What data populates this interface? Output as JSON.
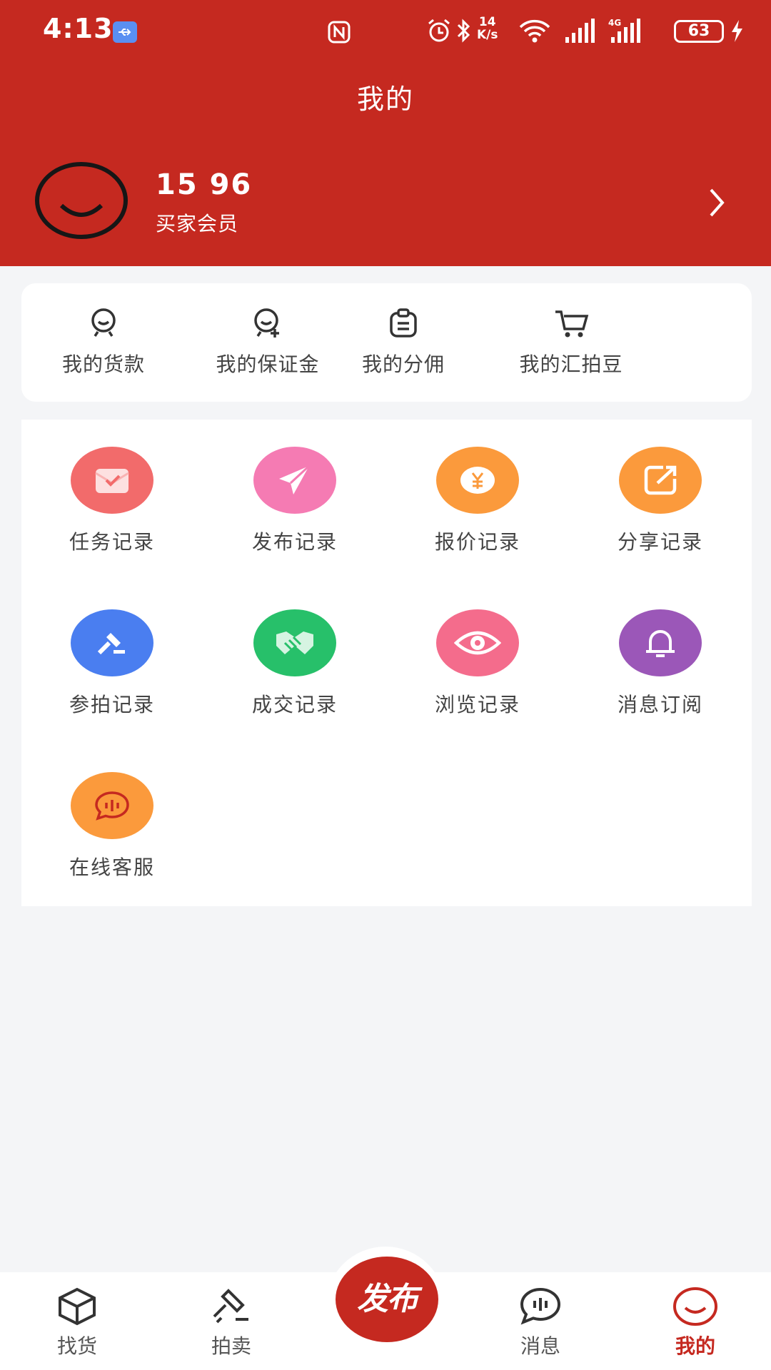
{
  "status_bar": {
    "time": "4:13",
    "net_speed_value": "14",
    "net_speed_unit": "K/s",
    "network": "4G",
    "battery": "63"
  },
  "header": {
    "title": "我的"
  },
  "profile": {
    "phone": "15        96",
    "member_type": "买家会员"
  },
  "wallet": {
    "items": [
      {
        "label": "我的货款",
        "icon": "smile-face-icon"
      },
      {
        "label": "我的保证金",
        "icon": "user-add-icon"
      },
      {
        "label": "我的分佣",
        "icon": "clipboard-icon"
      },
      {
        "label": "我的汇拍豆",
        "icon": "cart-icon"
      }
    ]
  },
  "records": {
    "items": [
      {
        "label": "任务记录",
        "icon": "task-icon",
        "color": "#f26b6b"
      },
      {
        "label": "发布记录",
        "icon": "send-icon",
        "color": "#f57bb3"
      },
      {
        "label": "报价记录",
        "icon": "yen-coin-icon",
        "color": "#fb9a3c"
      },
      {
        "label": "分享记录",
        "icon": "share-icon",
        "color": "#fb9a3c"
      },
      {
        "label": "参拍记录",
        "icon": "gavel-icon",
        "color": "#4a7ef0"
      },
      {
        "label": "成交记录",
        "icon": "handshake-icon",
        "color": "#27c06a"
      },
      {
        "label": "浏览记录",
        "icon": "eye-icon",
        "color": "#f46c8c"
      },
      {
        "label": "消息订阅",
        "icon": "bell-icon",
        "color": "#9b57b8"
      },
      {
        "label": "在线客服",
        "icon": "chat-icon",
        "color": "#fb9a3c"
      }
    ]
  },
  "tabbar": {
    "items": [
      {
        "label": "找货",
        "icon": "cube-icon"
      },
      {
        "label": "拍卖",
        "icon": "hammer-icon"
      },
      {
        "label": "发布",
        "icon": "publish-icon"
      },
      {
        "label": "消息",
        "icon": "chat-bubble-icon"
      },
      {
        "label": "我的",
        "icon": "smile-icon",
        "active": true
      }
    ]
  },
  "colors": {
    "brand": "#c52920",
    "background": "#f4f5f7"
  }
}
